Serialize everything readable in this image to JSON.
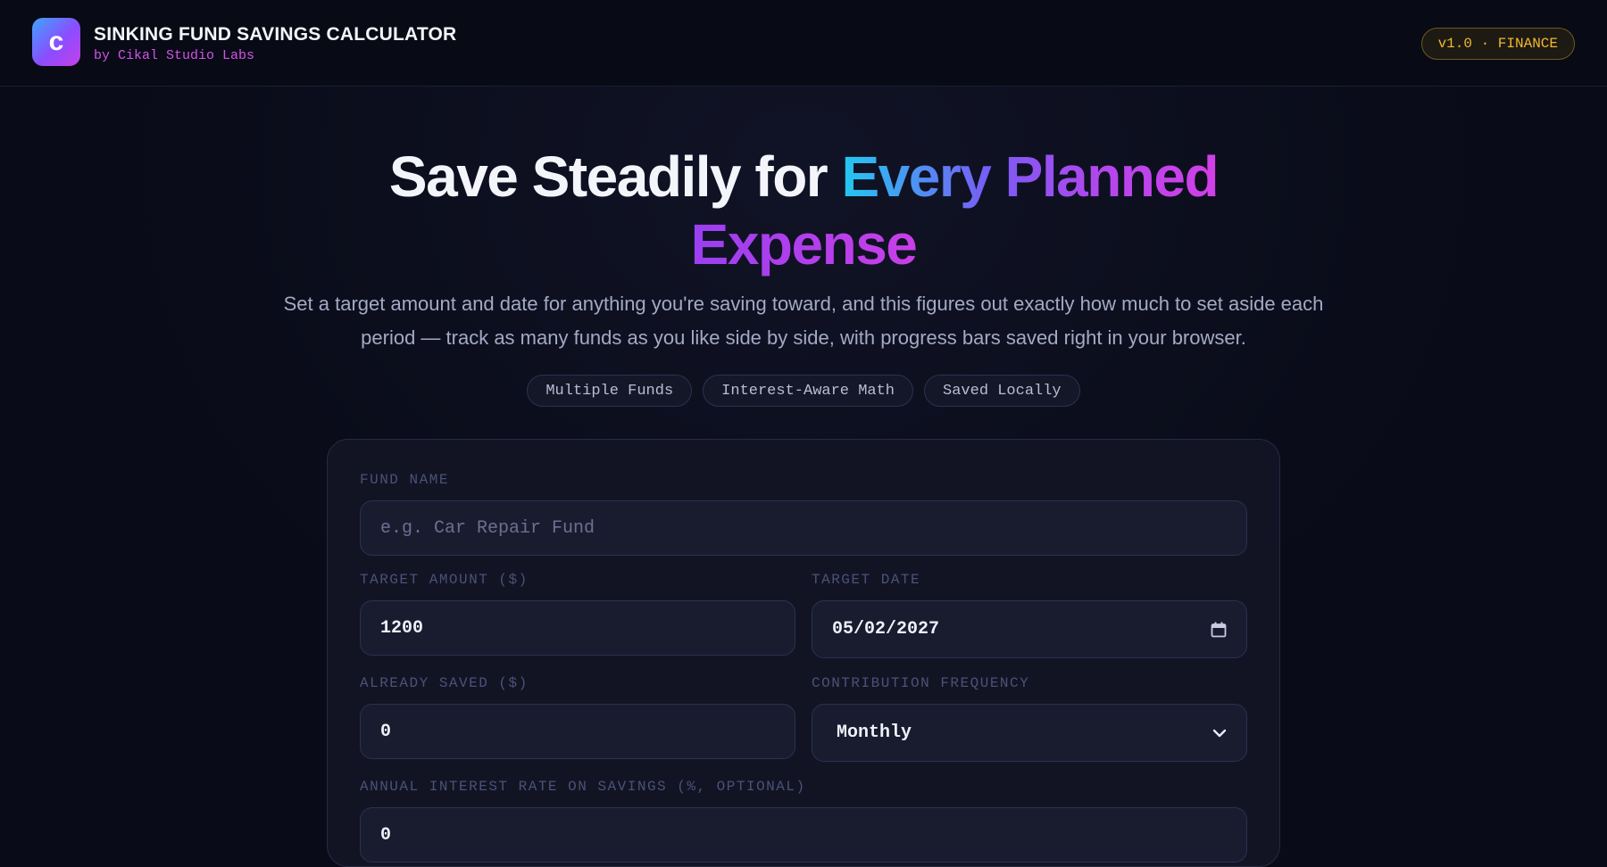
{
  "header": {
    "logo_letter": "c",
    "title": "SINKING FUND SAVINGS CALCULATOR",
    "subtitle": "by Cikal Studio Labs",
    "version": "v1.0 · FINANCE"
  },
  "hero": {
    "title_part1": "Save Steadily for ",
    "title_part2": "Every Planned",
    "title_part3": "Expense",
    "description": "Set a target amount and date for anything you're saving toward, and this figures out exactly how much to set aside each period — track as many funds as you like side by side, with progress bars saved right in your browser.",
    "chips": [
      "Multiple Funds",
      "Interest-Aware Math",
      "Saved Locally"
    ]
  },
  "form": {
    "fund_name": {
      "label": "FUND NAME",
      "value": "",
      "placeholder": "e.g. Car Repair Fund"
    },
    "target_amount": {
      "label": "TARGET AMOUNT ($)",
      "value": "1200"
    },
    "target_date": {
      "label": "TARGET DATE",
      "value": "05/02/2027",
      "icon": "calendar-icon"
    },
    "already_saved": {
      "label": "ALREADY SAVED ($)",
      "value": "0"
    },
    "frequency": {
      "label": "CONTRIBUTION FREQUENCY",
      "value": "Monthly",
      "icon": "chevron-down-icon"
    },
    "interest_rate": {
      "label": "ANNUAL INTEREST RATE ON SAVINGS (%, OPTIONAL)",
      "value": "0"
    }
  },
  "colors": {
    "background": "#090b18",
    "accent_cyan": "#22c8f0",
    "accent_purple": "#b446ec",
    "brand_magenta": "#d452e8",
    "badge_gold": "#f2b632"
  }
}
